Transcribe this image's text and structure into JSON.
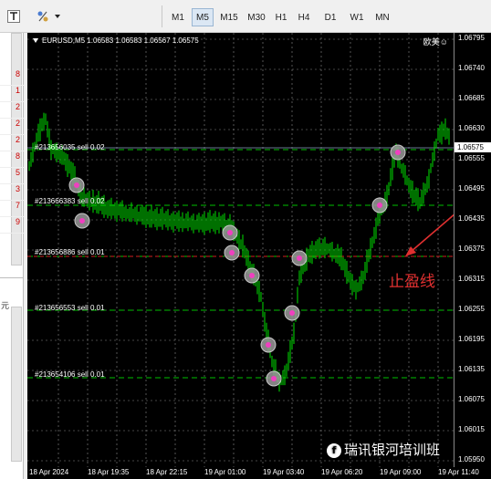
{
  "toolbar": {
    "timeframes": [
      "M1",
      "M5",
      "M15",
      "M30",
      "H1",
      "H4",
      "D1",
      "W1",
      "MN"
    ],
    "active_timeframe": "M5"
  },
  "left_panel": {
    "values": [
      "8",
      "1",
      "2",
      "2",
      "2",
      "8",
      "5",
      "3",
      "7",
      "9"
    ],
    "lower_text": "元"
  },
  "chart": {
    "title": "EURUSD,M5  1.06583 1.06583 1.06567 1.06575",
    "corner_text": "欧美☺",
    "orders": [
      {
        "label": "#213656035 sell 0.02"
      },
      {
        "label": "#213666383 sell 0.02"
      },
      {
        "label": "#213656886 sell 0.01"
      },
      {
        "label": "#213656553 sell 0.01"
      },
      {
        "label": "#213654106 sell 0.01"
      }
    ],
    "annotation": "止盈线",
    "colors": {
      "background": "#000000",
      "candles": "#00e000",
      "grid": "#8a8a8a",
      "order_lines": "#00c000",
      "tp_line": "#d02020",
      "annotation": "#e03030"
    }
  },
  "price_axis": {
    "labels": [
      "1.06795",
      "1.06740",
      "1.06685",
      "1.06630",
      "1.06575",
      "1.06555",
      "1.06495",
      "1.06435",
      "1.06375",
      "1.06315",
      "1.06255",
      "1.06195",
      "1.06135",
      "1.06075",
      "1.06015",
      "1.05950"
    ],
    "current": "1.06575"
  },
  "time_axis": {
    "labels": [
      "18 Apr 2024",
      "18 Apr 19:35",
      "18 Apr 22:15",
      "19 Apr 01:00",
      "19 Apr 03:40",
      "19 Apr 06:20",
      "19 Apr 09:00",
      "19 Apr 11:40"
    ]
  },
  "watermark": {
    "logo": "f",
    "text": "瑞讯银河培训班"
  }
}
